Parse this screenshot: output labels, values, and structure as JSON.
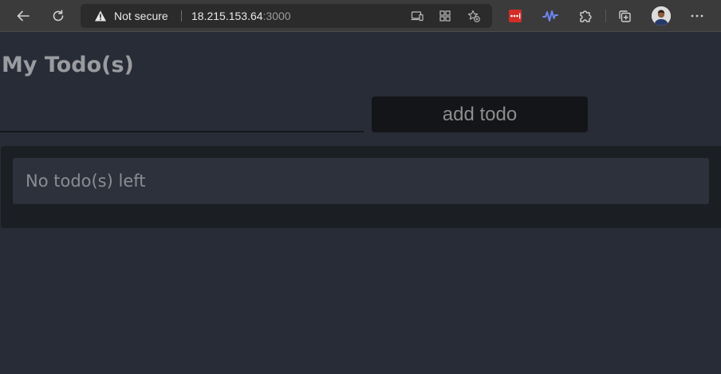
{
  "browser": {
    "icons": {
      "back": "arrow-left-icon",
      "reload": "reload-icon",
      "warning": "warning-triangle-icon",
      "app_available": "app-available-icon",
      "apps": "apps-grid-icon",
      "favorite": "favorite-star-icon",
      "lastpass": "lastpass-icon",
      "wave_extension": "wave-icon",
      "extensions": "puzzle-icon",
      "collections": "collections-icon",
      "profile": "profile-avatar",
      "more": "more-dots-icon"
    },
    "address": {
      "status": "Not secure",
      "host": "18.215.153.64",
      "port": ":3000"
    },
    "colors": {
      "toolbar": "#3b3b3b",
      "address_bg": "#2b2b2b",
      "lastpass_red": "#d32d27",
      "wave_blue": "#6d84f0"
    }
  },
  "app": {
    "title": "My Todo(s)",
    "input_value": "",
    "add_button_label": "add todo",
    "empty_message": "No todo(s) left",
    "colors": {
      "page_bg": "#282c37",
      "panel_bg": "#1b1e23",
      "item_bg": "#2d313b",
      "button_bg": "#141518"
    }
  }
}
